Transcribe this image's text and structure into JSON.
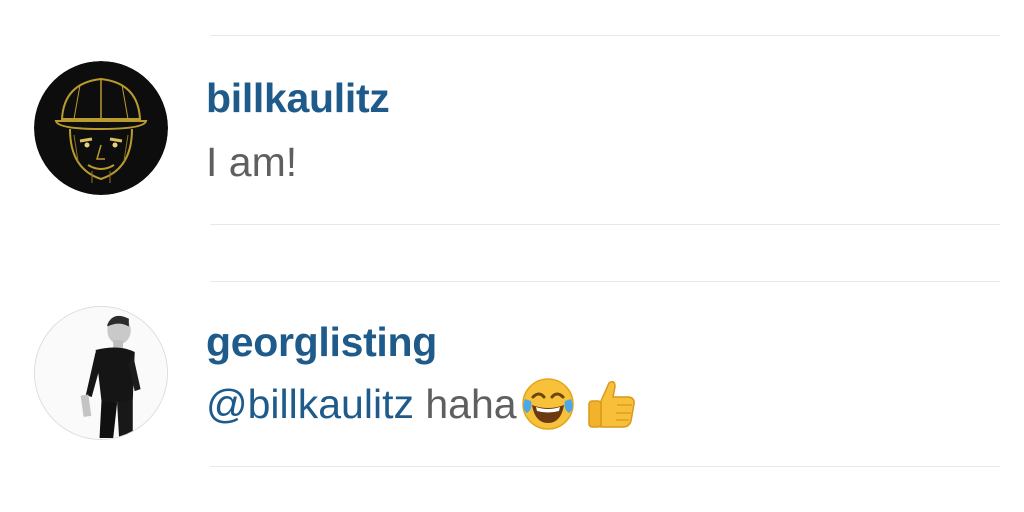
{
  "comments": [
    {
      "username": "billkaulitz",
      "text": "I am!",
      "avatar": "illustrated-face-cap-avatar"
    },
    {
      "username": "georglisting",
      "mention": "@billkaulitz",
      "text": " haha",
      "emojis": [
        "face-with-tears-of-joy",
        "thumbs-up"
      ],
      "avatar": "man-in-black-shirt-avatar"
    }
  ],
  "colors": {
    "username": "#1f5b8a",
    "body_text": "#5f5f5f",
    "divider": "#e8e8e8"
  }
}
